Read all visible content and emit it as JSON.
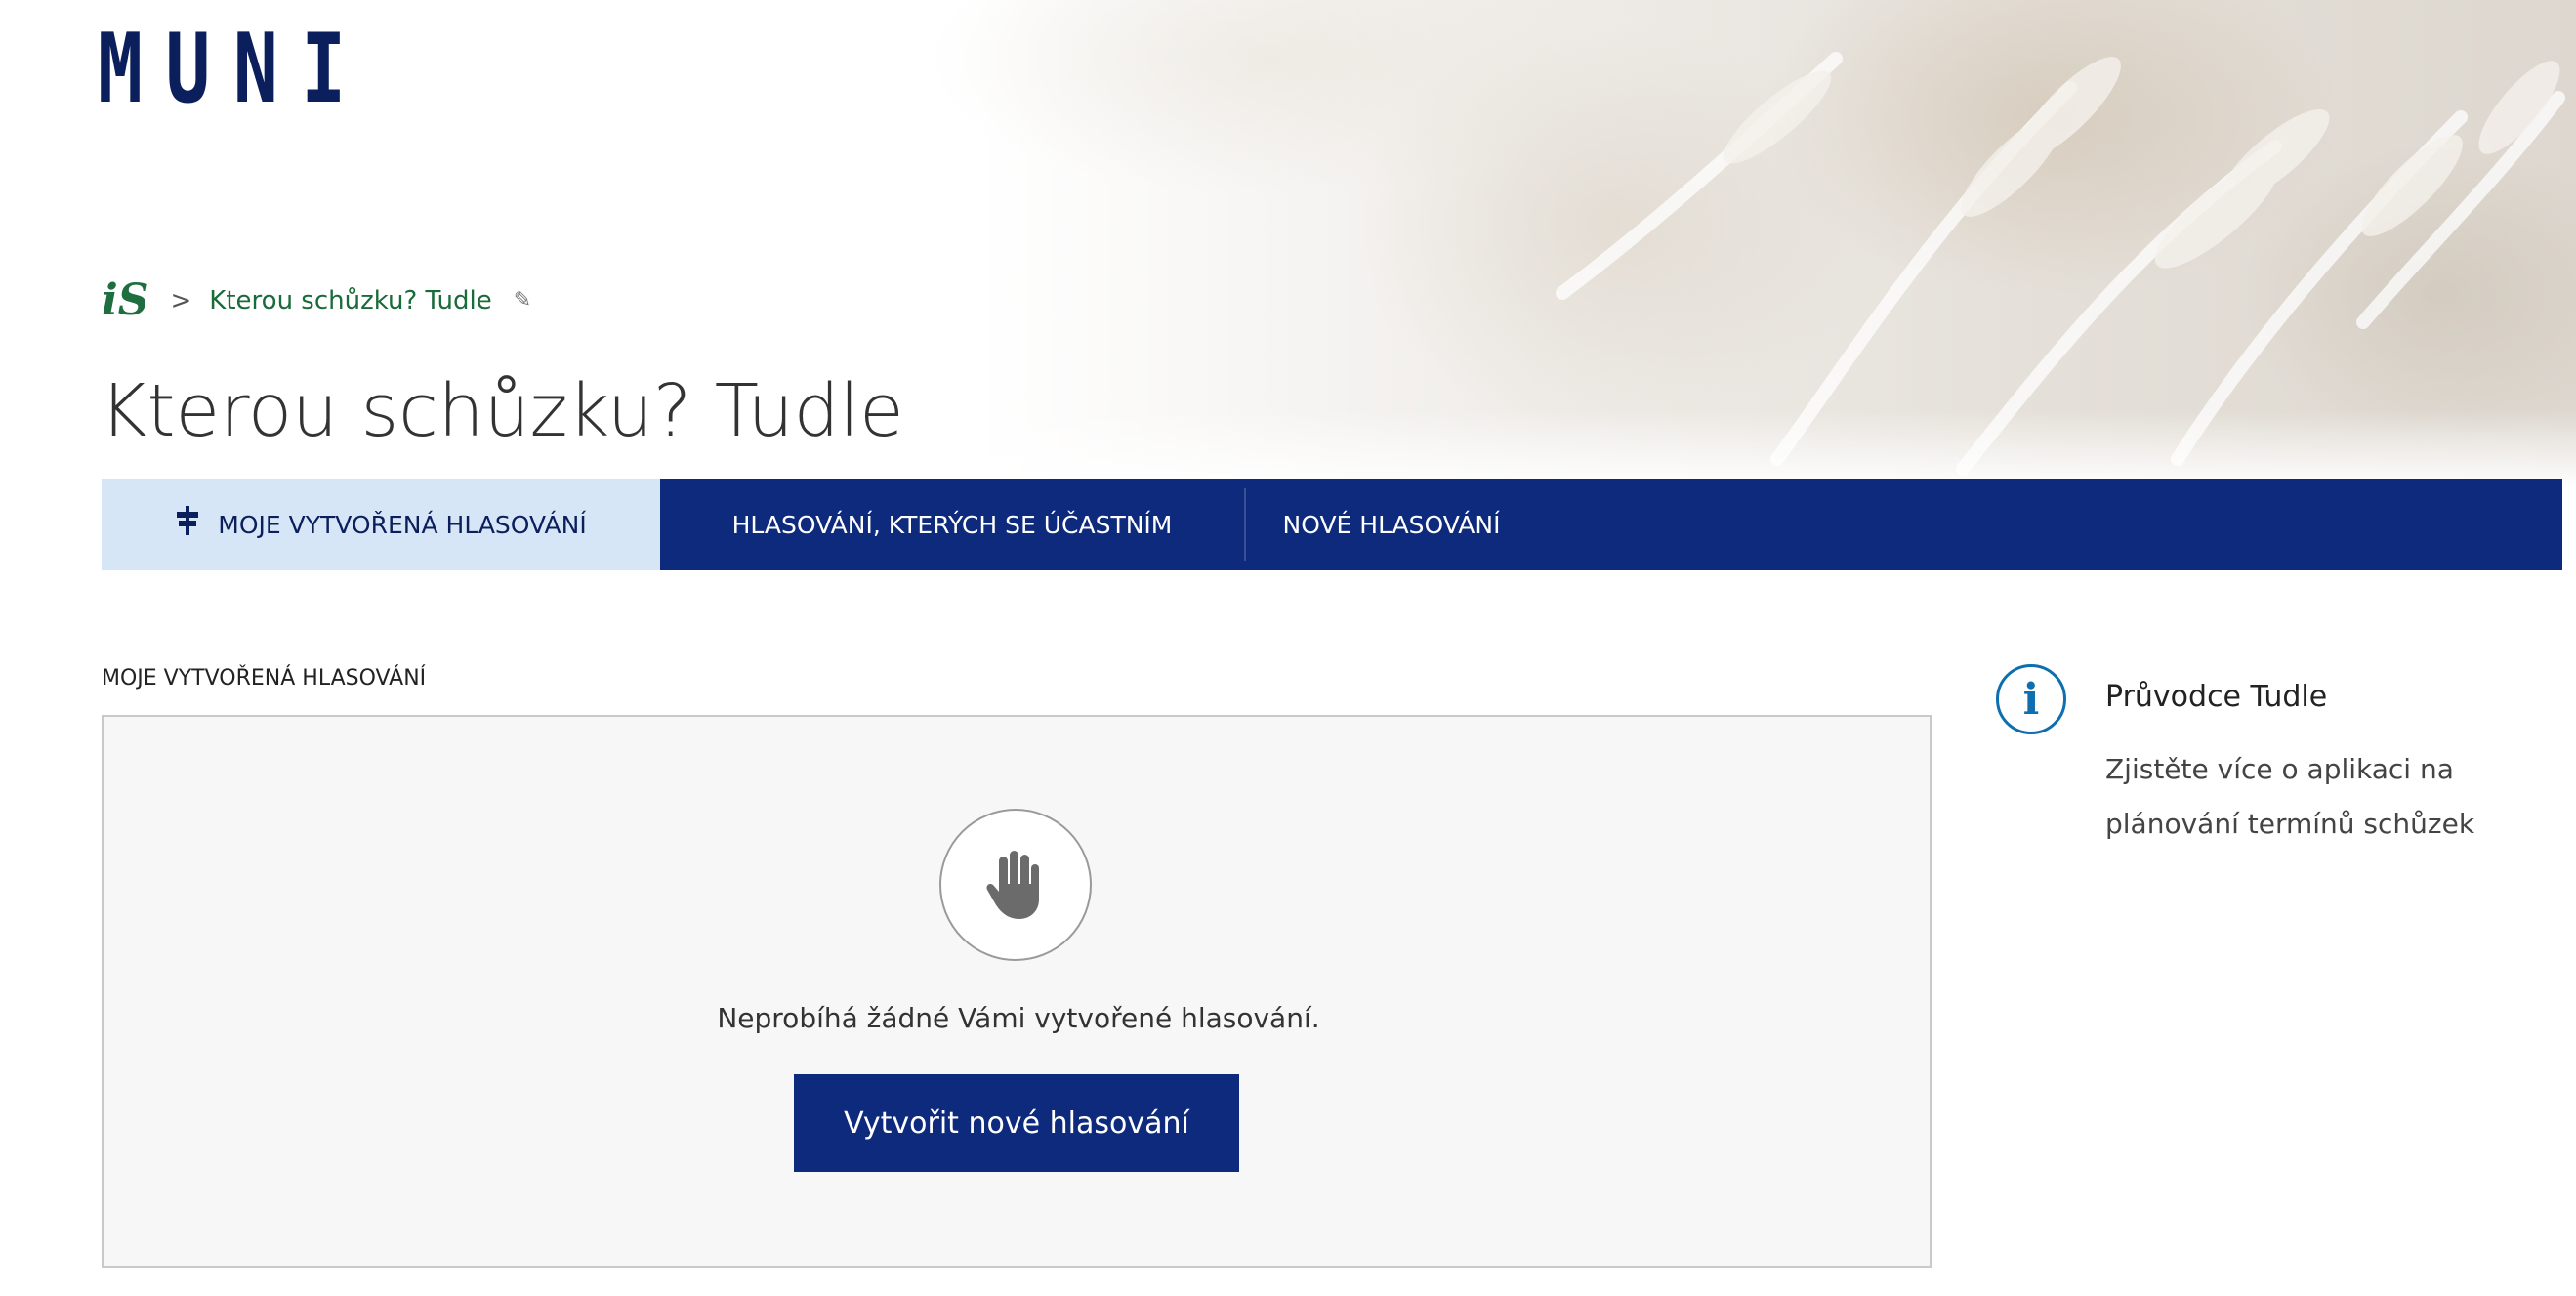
{
  "brand": {
    "logo_text": "MUNI"
  },
  "breadcrumb": {
    "home_logo": "iS",
    "separator": ">",
    "current": "Kterou schůzku? Tudle",
    "pin_icon": "pin-icon"
  },
  "page": {
    "title": "Kterou schůzku? Tudle"
  },
  "tabs": [
    {
      "label": "MOJE VYTVOŘENÁ HLASOVÁNÍ",
      "active": true,
      "icon": "signpost-icon"
    },
    {
      "label": "HLASOVÁNÍ, KTERÝCH SE ÚČASTNÍM",
      "active": false
    },
    {
      "label": "NOVÉ HLASOVÁNÍ",
      "active": false
    }
  ],
  "section": {
    "label": "MOJE VYTVOŘENÁ HLASOVÁNÍ"
  },
  "empty_state": {
    "icon": "stop-hand-icon",
    "message": "Neprobíhá žádné Vámi vytvořené hlasování.",
    "button_label": "Vytvořit nové hlasování"
  },
  "guide": {
    "icon": "info-icon",
    "title": "Průvodce Tudle",
    "description": "Zjistěte více o aplikaci na plánování termínů schůzek"
  },
  "colors": {
    "brand_navy": "#0e2a7d",
    "active_tab_bg": "#d7e6f6",
    "breadcrumb_green": "#1a6b3a",
    "info_blue": "#0e6fb0"
  }
}
